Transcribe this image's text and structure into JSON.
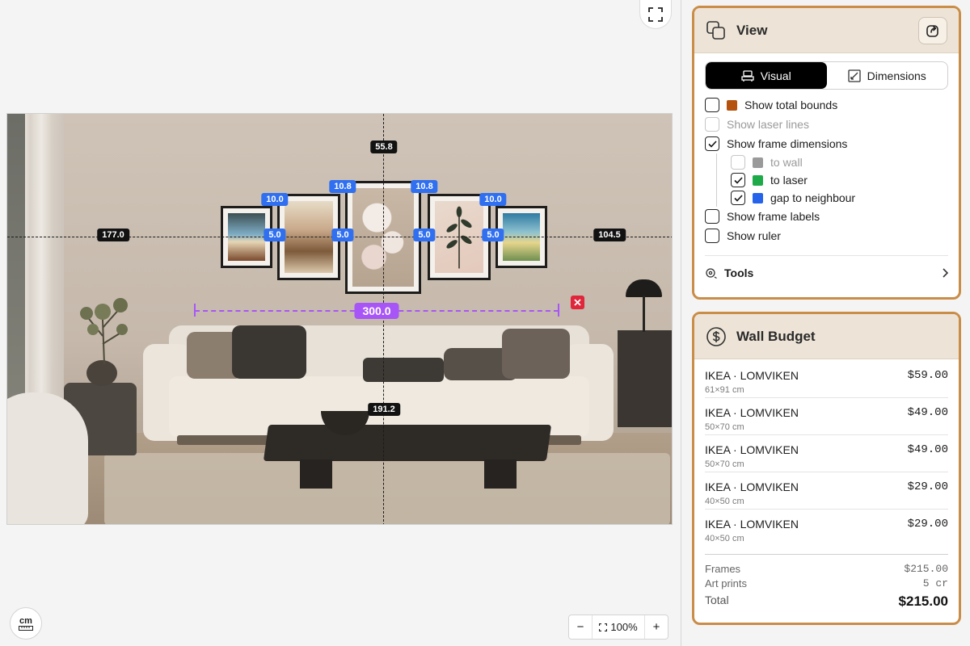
{
  "canvas": {
    "measurements": {
      "top": "55.8",
      "left": "177.0",
      "right": "104.5",
      "bottom": "191.2",
      "gaps_vertical": [
        "10.0",
        "10.8",
        "10.8",
        "10.0"
      ],
      "gaps_horizontal": [
        "5.0",
        "5.0",
        "5.0",
        "5.0"
      ],
      "ruler_length": "300.0"
    },
    "unit_label": "cm",
    "zoom_level": "100%",
    "zoom_minus": "−",
    "zoom_plus": "+"
  },
  "view_panel": {
    "title": "View",
    "tabs": [
      {
        "label": "Visual",
        "active": true
      },
      {
        "label": "Dimensions",
        "active": false
      }
    ],
    "options": {
      "total_bounds": {
        "label": "Show total bounds",
        "checked": false,
        "color": "#b5520f"
      },
      "laser_lines": {
        "label": "Show laser lines",
        "checked": false,
        "disabled": true
      },
      "frame_dimensions": {
        "label": "Show frame dimensions",
        "checked": true
      },
      "to_wall": {
        "label": "to wall",
        "checked": false,
        "disabled": true,
        "color": "#9a9a9a"
      },
      "to_laser": {
        "label": "to laser",
        "checked": true,
        "color": "#1faa4a"
      },
      "gap_neighbour": {
        "label": "gap to neighbour",
        "checked": true,
        "color": "#2563eb"
      },
      "frame_labels": {
        "label": "Show frame labels",
        "checked": false
      },
      "ruler": {
        "label": "Show ruler",
        "checked": false
      }
    },
    "tools_label": "Tools"
  },
  "budget_panel": {
    "title": "Wall Budget",
    "items": [
      {
        "name": "IKEA · LOMVIKEN",
        "size": "61×91 cm",
        "price": "$59.00"
      },
      {
        "name": "IKEA · LOMVIKEN",
        "size": "50×70 cm",
        "price": "$49.00"
      },
      {
        "name": "IKEA · LOMVIKEN",
        "size": "50×70 cm",
        "price": "$49.00"
      },
      {
        "name": "IKEA · LOMVIKEN",
        "size": "40×50 cm",
        "price": "$29.00"
      },
      {
        "name": "IKEA · LOMVIKEN",
        "size": "40×50 cm",
        "price": "$29.00"
      }
    ],
    "frames_label": "Frames",
    "frames_value": "$215.00",
    "prints_label": "Art prints",
    "prints_value": "5 cr",
    "total_label": "Total",
    "total_value": "$215.00"
  },
  "colors": {
    "accent_border": "#c98d48",
    "gap_blue": "#2f6ff0",
    "ruler_purple": "#a855f7",
    "close_red": "#e0263a"
  }
}
